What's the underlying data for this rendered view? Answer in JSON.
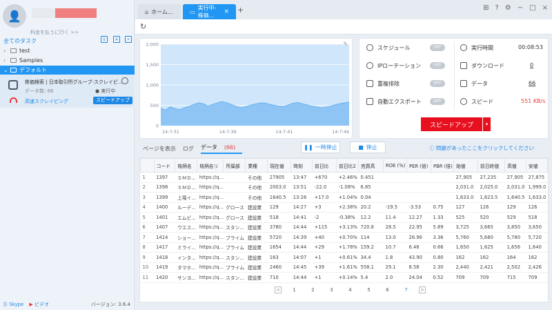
{
  "sidebar": {
    "upgrade_link": "料金を払うに行く >>",
    "tasks_label": "全てのタスク",
    "tree": [
      {
        "label": "test",
        "expanded": false
      },
      {
        "label": "Samples",
        "expanded": false
      },
      {
        "label": "デフォルト",
        "expanded": true
      }
    ],
    "task": {
      "title": "株価検索 | 日本取引所グループ-スクレイピ...",
      "data_count": "データ数: 66",
      "status": "● 実行中",
      "mode": "高速スクレイピング",
      "speed_button": "スピードアップ"
    },
    "footer": {
      "skype": "Skype",
      "video": "ビデオ",
      "version": "バージョン: 3.6.4"
    }
  },
  "tabs": [
    {
      "label": "ホーム...",
      "active": false
    },
    {
      "label": "実行中-株価...",
      "active": true
    }
  ],
  "info": {
    "schedule": "スケジュール",
    "schedule_toggle": "OFF",
    "runtime_label": "実行時間",
    "runtime_value": "00:08:53",
    "ip_rotation": "IPローテーション",
    "ip_toggle": "OFF",
    "download_label": "ダウンロード",
    "download_value": "0",
    "dedupe": "重複排除",
    "dedupe_toggle": "OFF",
    "data_label": "データ",
    "data_value": "66",
    "auto_export": "自動エクスポート",
    "auto_export_toggle": "OFF",
    "speed_label": "スピード",
    "speed_value": "551 KB/s",
    "speedup_button": "スピードアップ"
  },
  "subtabs": {
    "page": "ページを表示",
    "log": "ログ",
    "data": "データ",
    "data_count": "(66)"
  },
  "controls": {
    "pause": "一時停止",
    "stop": "停止",
    "help": "問題があったここをクリックしてください"
  },
  "chart_data": {
    "type": "area",
    "x_ticks": [
      "14:7:31",
      "14:7:36",
      "14:7:41",
      "14:7:46"
    ],
    "y_ticks": [
      0,
      500,
      1000,
      1500,
      2000
    ],
    "ylim": [
      0,
      2000
    ],
    "x": [
      0,
      1,
      2,
      3,
      4,
      5,
      6,
      7,
      8,
      9,
      10,
      11,
      12,
      13,
      14,
      15,
      16,
      17,
      18,
      19,
      20,
      21,
      22,
      23,
      24,
      25,
      26,
      27,
      28,
      29,
      30,
      31,
      32,
      33,
      34,
      35,
      36,
      37,
      38,
      39,
      40
    ],
    "values": [
      430,
      380,
      460,
      420,
      390,
      440,
      470,
      520,
      560,
      540,
      480,
      520,
      560,
      590,
      560,
      520,
      470,
      440,
      460,
      500,
      530,
      550,
      560,
      530,
      500,
      480,
      470,
      500,
      550,
      570,
      540,
      510,
      480,
      460,
      440,
      450,
      480,
      510,
      540,
      560,
      580
    ],
    "grid": true
  },
  "table": {
    "columns": [
      "",
      "コード",
      "銘柄名",
      "銘柄名リ",
      "所属部",
      "業種",
      "現在値",
      "時刻",
      "前日比",
      "前日比2",
      "売買高",
      "ROE (%)",
      "PER (倍)",
      "PBR (倍)",
      "始値",
      "前日終値",
      "高値",
      "安値"
    ],
    "rows": [
      [
        "1",
        "1397",
        "ＳＭＤ...",
        "https://q...",
        "",
        "その他",
        "27905",
        "13:47",
        "+670",
        "+2.46%",
        "0.451",
        "",
        "",
        "",
        "27,905",
        "27,235",
        "27,905",
        "27,875"
      ],
      [
        "2",
        "1398",
        "ＳＭＤ...",
        "https://q...",
        "",
        "その他",
        "2003.0",
        "13:51",
        "-22.0",
        "-1.08%",
        "6.85",
        "",
        "",
        "",
        "2,031.0",
        "2,025.0",
        "2,031.0",
        "1,999.0"
      ],
      [
        "3",
        "1399",
        "上場イ...",
        "https://q...",
        "",
        "その他",
        "1640.5",
        "13:26",
        "+17.0",
        "+1.04%",
        "0.04",
        "",
        "",
        "",
        "1,633.0",
        "1,623.5",
        "1,640.5",
        "1,633.0"
      ],
      [
        "4",
        "1400",
        "ルーデ...",
        "https://q...",
        "グロース",
        "建設業",
        "129",
        "14:27",
        "+3",
        "+2.38%",
        "20.2",
        "-19.5",
        "-3.53",
        "0.75",
        "127",
        "126",
        "129",
        "126"
      ],
      [
        "5",
        "1401",
        "エムビ...",
        "https://q...",
        "グロース",
        "建設業",
        "518",
        "14:41",
        "-2",
        "-0.38%",
        "12.2",
        "11.4",
        "12.27",
        "1.33",
        "525",
        "520",
        "529",
        "518"
      ],
      [
        "6",
        "1407",
        "ウエス...",
        "https://q...",
        "スタン...",
        "建設業",
        "3780",
        "14:44",
        "+115",
        "+3.13%",
        "720.8",
        "28.5",
        "22.95",
        "5.89",
        "3,725",
        "3,665",
        "3,850",
        "3,650"
      ],
      [
        "7",
        "1414",
        "ショー...",
        "https://q...",
        "プライム",
        "建設業",
        "5720",
        "14:39",
        "+40",
        "+0.70%",
        "114",
        "13.0",
        "26.96",
        "3.36",
        "5,760",
        "5,680",
        "5,780",
        "5,720"
      ],
      [
        "8",
        "1417",
        "ミライ...",
        "https://q...",
        "プライム",
        "建設業",
        "1654",
        "14:44",
        "+29",
        "+1.78%",
        "159.2",
        "10.7",
        "6.48",
        "0.66",
        "1,650",
        "1,625",
        "1,656",
        "1,640"
      ],
      [
        "9",
        "1418",
        "インタ...",
        "https://q...",
        "スタン...",
        "建設業",
        "163",
        "14:07",
        "+1",
        "+0.61%",
        "34.4",
        "1.8",
        "43.90",
        "0.80",
        "162",
        "162",
        "164",
        "162"
      ],
      [
        "10",
        "1419",
        "タマホ...",
        "https://q...",
        "プライム",
        "建設業",
        "2460",
        "14:45",
        "+39",
        "+1.61%",
        "558.1",
        "29.1",
        "8.58",
        "2.30",
        "2,440",
        "2,421",
        "2,502",
        "2,426"
      ],
      [
        "11",
        "1420",
        "サンヨ...",
        "https://q...",
        "スタン...",
        "建設業",
        "710",
        "14:44",
        "+1",
        "+0.14%",
        "5.4",
        "2.0",
        "24.04",
        "0.52",
        "709",
        "709",
        "715",
        "709"
      ]
    ]
  },
  "pager": {
    "prev": "<",
    "pages": [
      "1",
      "2",
      "3",
      "4",
      "5",
      "6",
      "7"
    ],
    "current": "7",
    "next": ">"
  }
}
